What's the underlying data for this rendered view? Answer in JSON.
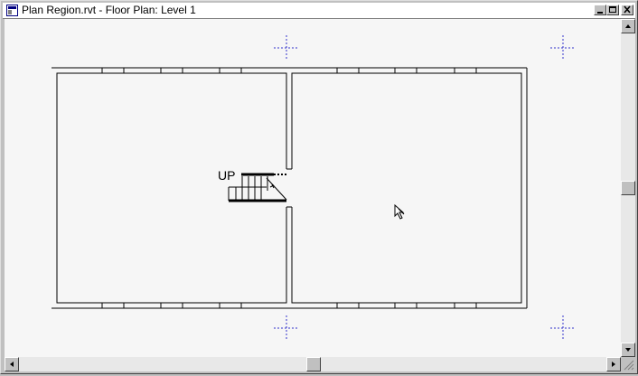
{
  "window": {
    "title": "Plan Region.rvt - Floor Plan: Level 1",
    "icon": "revit-view-icon",
    "buttons": {
      "minimize": "minimize-icon",
      "maximize": "maximize-icon",
      "close": "close-icon"
    }
  },
  "drawing": {
    "stair_label": "UP",
    "background": "#f6f6f6",
    "grid_marker_color": "#3333cc"
  },
  "scrollbars": {
    "vertical": {
      "up": "arrow-up-icon",
      "down": "arrow-down-icon"
    },
    "horizontal": {
      "left": "arrow-left-icon",
      "right": "arrow-right-icon"
    }
  }
}
